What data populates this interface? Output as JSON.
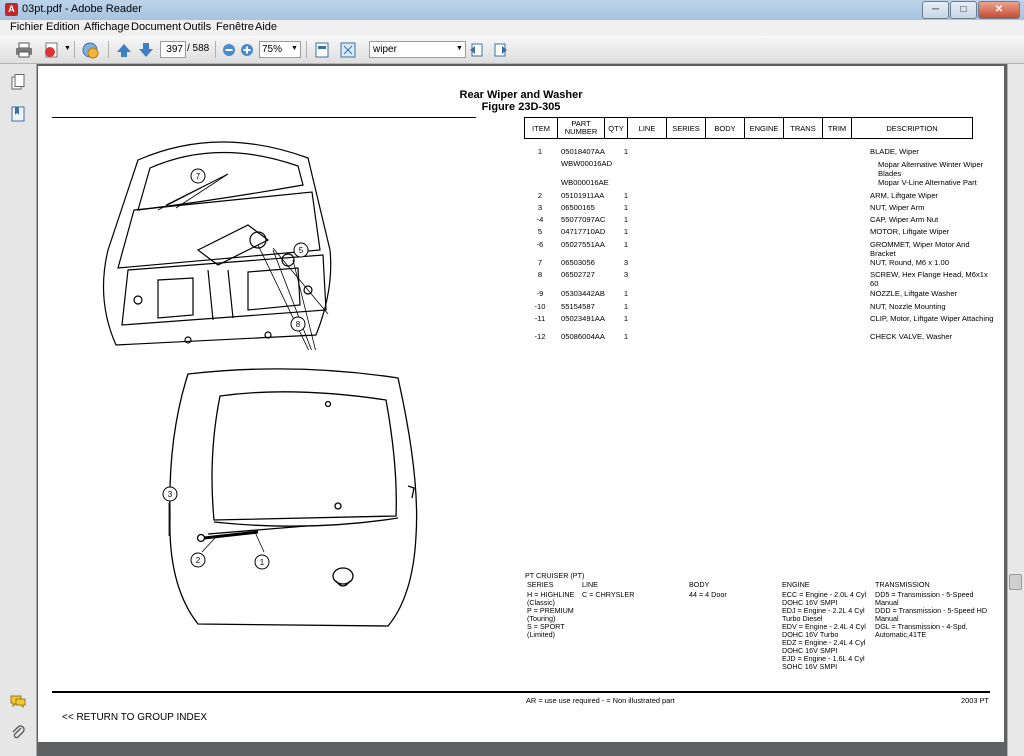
{
  "window": {
    "title": "03pt.pdf - Adobe Reader",
    "min": "─",
    "max": "□",
    "close": "✕"
  },
  "menu": [
    "Fichier",
    "Edition",
    "Affichage",
    "Document",
    "Outils",
    "Fenêtre",
    "Aide"
  ],
  "toolbar": {
    "page_current": "397",
    "page_total": "/ 588",
    "zoom": "75%",
    "search": "wiper"
  },
  "document": {
    "title": "Rear Wiper and Washer",
    "figure": "Figure 23D-305",
    "headers": [
      "ITEM",
      "PART\nNUMBER",
      "QTY",
      "LINE",
      "SERIES",
      "BODY",
      "ENGINE",
      "TRANS",
      "TRIM",
      "DESCRIPTION"
    ],
    "parts": [
      {
        "item": "1",
        "part": "05018407AA",
        "qty": "1",
        "desc": "BLADE, Wiper"
      },
      {
        "item": "",
        "part": "WBW00016AD",
        "qty": "",
        "desc": "Mopar Alternative Winter Wiper Blades"
      },
      {
        "item": "",
        "part": "WB000016AE",
        "qty": "",
        "desc": "Mopar V-Line Alternative Part"
      },
      {
        "item": "2",
        "part": "05101911AA",
        "qty": "1",
        "desc": "ARM, Liftgate Wiper"
      },
      {
        "item": "3",
        "part": "06500165",
        "qty": "1",
        "desc": "NUT, Wiper Arm"
      },
      {
        "item": "-4",
        "part": "55077097AC",
        "qty": "1",
        "desc": "CAP, Wiper Arm Nut"
      },
      {
        "item": "5",
        "part": "04717710AD",
        "qty": "1",
        "desc": "MOTOR, Liftgate Wiper"
      },
      {
        "item": "-6",
        "part": "05027551AA",
        "qty": "1",
        "desc": "GROMMET, Wiper Motor And Bracket"
      },
      {
        "item": "7",
        "part": "06503056",
        "qty": "3",
        "desc": "NUT, Round, M6 x 1.00"
      },
      {
        "item": "8",
        "part": "06502727",
        "qty": "3",
        "desc": "SCREW, Hex Flange Head, M6x1x 60"
      },
      {
        "item": "-9",
        "part": "05303442AB",
        "qty": "1",
        "desc": "NOZZLE, Liftgate Washer"
      },
      {
        "item": "-10",
        "part": "55154587",
        "qty": "1",
        "desc": "NUT, Nozzle Mounting"
      },
      {
        "item": "-11",
        "part": "05023491AA",
        "qty": "1",
        "desc": "CLIP, Motor, Liftgate Wiper Attaching"
      },
      {
        "item": "-12",
        "part": "05086004AA",
        "qty": "1",
        "desc": "CHECK VALVE, Washer"
      }
    ],
    "legend": {
      "title": "PT CRUISER (PT)",
      "series_h": "SERIES",
      "series": "H = HIGHLINE\n(Classic)\nP = PREMIUM\n(Touring)\nS = SPORT\n(Limited)",
      "line_h": "LINE",
      "line": "C = CHRYSLER",
      "body_h": "BODY",
      "body": "44 = 4 Door",
      "engine_h": "ENGINE",
      "engine": "ECC = Engine - 2.0L 4 Cyl\nDOHC 16V SMPI\nEDJ = Engine - 2.2L 4 Cyl\nTurbo Diesel\nEDV = Engine - 2.4L 4 Cyl\nDOHC 16V Turbo\nEDZ = Engine - 2.4L 4 Cyl\nDOHC 16V SMPI\nEJD = Engine - 1.6L 4 Cyl\nSOHC 16V SMPI",
      "trans_h": "TRANSMISSION",
      "trans": "DD5 = Transmission - 5-Speed Manual\nDDD = Transmission - 5-Speed HD\nManual\nDGL = Transmission - 4-Spd.\nAutomatic,41TE"
    },
    "footer_note": "AR = use use required    - = Non illustrated part",
    "footer_year": "2003  PT",
    "return_link": "<< RETURN TO GROUP INDEX",
    "callouts": [
      "1",
      "2",
      "3",
      "5",
      "7",
      "8"
    ]
  }
}
